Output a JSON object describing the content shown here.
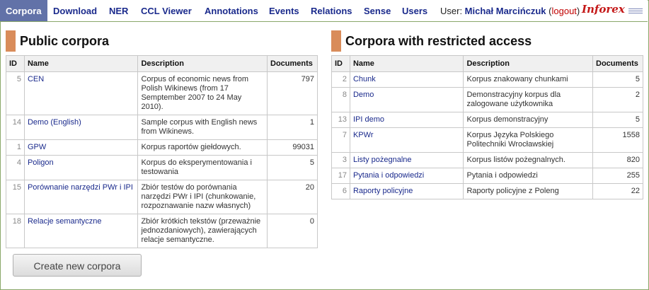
{
  "nav": {
    "items": [
      {
        "label": "Corpora"
      },
      {
        "label": "Download"
      },
      {
        "label": "NER"
      },
      {
        "label": "CCL Viewer"
      },
      {
        "label": "Annotations"
      },
      {
        "label": "Events"
      },
      {
        "label": "Relations"
      },
      {
        "label": "Sense"
      },
      {
        "label": "Users"
      }
    ],
    "user_prefix": "User: ",
    "user_name": "Michał Marcińczuk",
    "logout_open": " (",
    "logout_label": "logout",
    "logout_close": ")",
    "logo": "Inforex"
  },
  "public": {
    "title": "Public corpora",
    "columns": [
      "ID",
      "Name",
      "Description",
      "Documents"
    ],
    "rows": [
      {
        "id": "5",
        "name": "CEN",
        "description": "Corpus of economic news from Polish Wikinews (from 17 Semptember 2007 to 24 May 2010).",
        "documents": "797"
      },
      {
        "id": "14",
        "name": "Demo (English)",
        "description": "Sample corpus with English news from Wikinews.",
        "documents": "1"
      },
      {
        "id": "1",
        "name": "GPW",
        "description": "Korpus raportów giełdowych.",
        "documents": "99031"
      },
      {
        "id": "4",
        "name": "Poligon",
        "description": "Korpus do eksperymentowania i testowania",
        "documents": "5"
      },
      {
        "id": "15",
        "name": "Porównanie narzędzi PWr i IPI",
        "description": "Zbiór testów do porównania narzędzi PWr i IPI (chunkowanie, rozpoznawanie nazw własnych)",
        "documents": "20"
      },
      {
        "id": "18",
        "name": "Relacje semantyczne",
        "description": "Zbiór krótkich tekstów (przeważnie jednozdaniowych), zawierających relacje semantyczne.",
        "documents": "0"
      }
    ]
  },
  "restricted": {
    "title": "Corpora with restricted access",
    "columns": [
      "ID",
      "Name",
      "Description",
      "Documents"
    ],
    "rows": [
      {
        "id": "2",
        "name": "Chunk",
        "description": "Korpus znakowany chunkami",
        "documents": "5"
      },
      {
        "id": "8",
        "name": "Demo",
        "description": "Demonstracyjny korpus dla zalogowane użytkownika",
        "documents": "2"
      },
      {
        "id": "13",
        "name": "IPI demo",
        "description": "Korpus demonstracyjny",
        "documents": "5"
      },
      {
        "id": "7",
        "name": "KPWr",
        "description": "Korpus Języka Polskiego Politechniki Wrocławskiej",
        "documents": "1558"
      },
      {
        "id": "3",
        "name": "Listy pożegnalne",
        "description": "Korpus listów pożegnalnych.",
        "documents": "820"
      },
      {
        "id": "17",
        "name": "Pytania i odpowiedzi",
        "description": "Pytania i odpowiedzi",
        "documents": "255"
      },
      {
        "id": "6",
        "name": "Raporty policyjne",
        "description": "Raporty policyjne z Poleng",
        "documents": "22"
      }
    ]
  },
  "actions": {
    "create_label": "Create new corpora"
  }
}
